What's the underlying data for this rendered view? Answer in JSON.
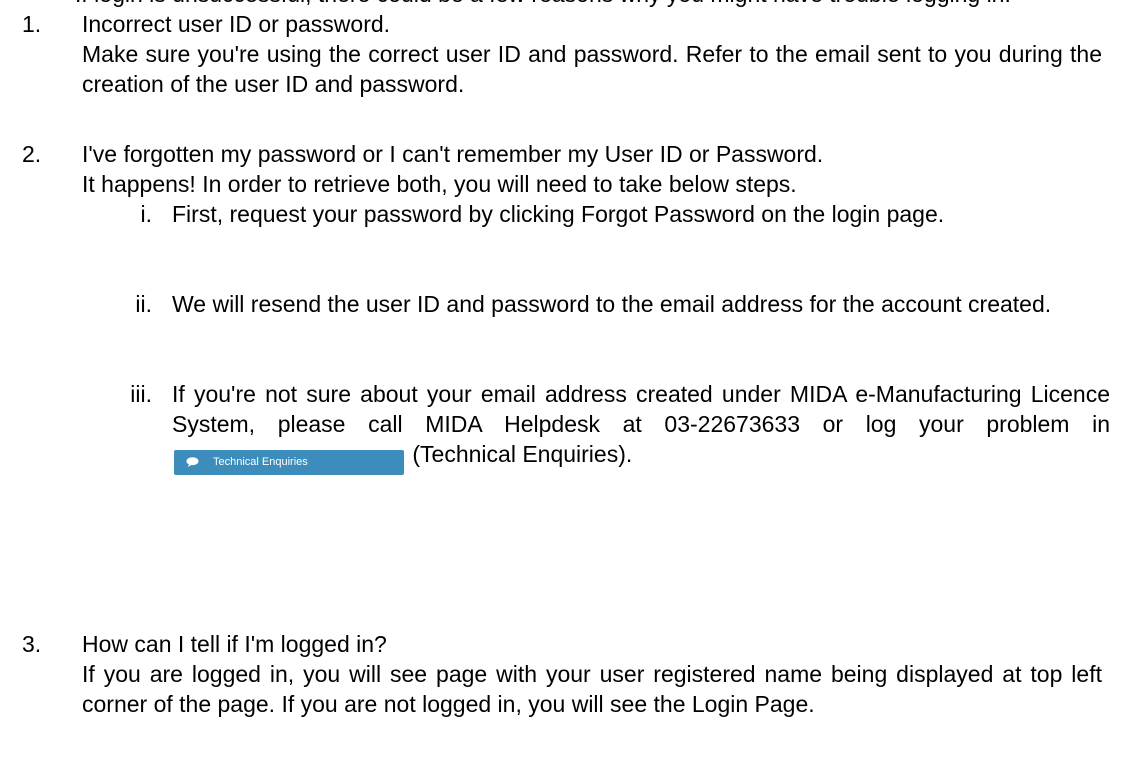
{
  "clipped_header": "If login is unsuccessful, there could be a few reasons why you might have trouble logging in:",
  "items": [
    {
      "number": "1.",
      "title": "Incorrect user ID or password.",
      "body": "Make sure you're using the correct user ID and password. Refer to the email sent to you during the creation of the user ID and password."
    },
    {
      "number": "2.",
      "title": "I've forgotten my password or I can't remember my User ID or Password.",
      "body": "It happens! In order to retrieve both, you will need to take below steps.",
      "steps": [
        {
          "numeral": "i.",
          "text": "First, request your password by clicking Forgot Password on the login page."
        },
        {
          "numeral": "ii.",
          "text": "We will resend the user ID and password to the email address for the account created."
        },
        {
          "numeral": "iii.",
          "text_before": "If you're not sure about your email address created under MIDA e-Manufacturing Licence System, please call MIDA Helpdesk at 03-22673633 or log your problem in",
          "button_label": "Technical Enquiries",
          "text_after": "(Technical Enquiries)."
        }
      ]
    },
    {
      "number": "3.",
      "title": "How can I tell if I'm logged in?",
      "body": "If you are logged in, you will see page with your user registered name being displayed at top left corner of the page. If you are not logged in, you will see the Login Page."
    }
  ],
  "colors": {
    "button_bg": "#3c8dbc",
    "button_text": "#ffffff"
  },
  "icons": {
    "button_icon": "chat-bubble-icon"
  }
}
